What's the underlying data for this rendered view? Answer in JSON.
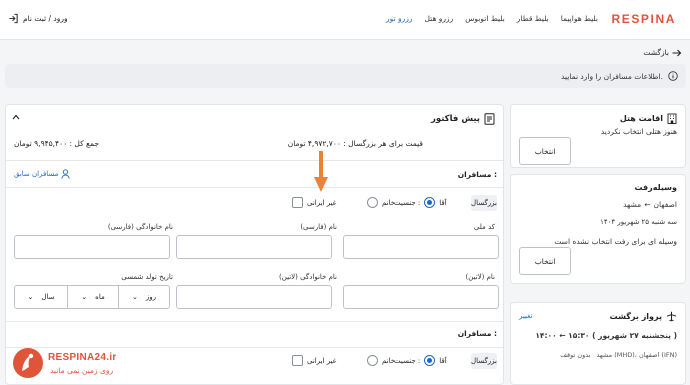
{
  "header": {
    "brand": "RESPINA",
    "nav": [
      {
        "label": "بلیط هواپیما",
        "active": false
      },
      {
        "label": "بلیط قطار",
        "active": false
      },
      {
        "label": "بلیط اتوبوس",
        "active": false
      },
      {
        "label": "رزرو هتل",
        "active": false
      },
      {
        "label": "رزرو تور",
        "active": true
      }
    ],
    "login": "ورود / ثبت نام"
  },
  "back_label": "بازگشت",
  "alert_text": "اطلاعات مسافران را وارد نمایید.",
  "invoice": {
    "title": "پیش فاکتور",
    "price_per_adult": "قیمت برای هر بزرگسال : ۴,۹۷۲,۷۰۰ تومان",
    "total": "جمع کل : ۹,۹۴۵,۴۰۰ تومان"
  },
  "passengers": {
    "title": "مسافران :",
    "prev_link": "مسافران سابق",
    "type": "بزرگسال",
    "gender_label": "جنسیت :",
    "male": "آقا",
    "female": "خانم",
    "foreign": "غیر ایرانی",
    "fields": {
      "national_code": "کد ملی",
      "name_fa": "نام (فارسی)",
      "last_name_fa": "نام خانوادگی (فارسی)",
      "name_en": "نام (لاتین)",
      "last_name_en": "نام خانوادگی (لاتین)",
      "birth_date": "تاریخ تولد شمسی"
    },
    "day": "روز",
    "month": "ماه",
    "year": "سال"
  },
  "hotel": {
    "title": "اقامت هتل",
    "text": "هنوز هتلی انتخاب نکردید",
    "button": "انتخاب"
  },
  "transport": {
    "title": "وسیله‌رفت",
    "from": "اصفهان",
    "to": "مشهد",
    "date": "سه شنبه ۲۵ شهریور ۱۴۰۴",
    "text": "وسیله ای برای رفت انتخاب نشده است",
    "button": "انتخاب"
  },
  "flight": {
    "title": "پرواز برگشت",
    "change": "تغییر",
    "times": "۱۴:۰۰ ← ۱۵:۳۰ ( پنجشنبه ۲۷ شهریور )",
    "route": "مشهد (MHD)، اصفهان (IFN)",
    "stops": "بدون توقف"
  },
  "watermark": {
    "brand": "RESPINA24.ir",
    "tagline": "روی زمین نمی مانید"
  },
  "colors": {
    "brand": "#e0543a",
    "link": "#1b67c8",
    "arrow": "#e8843a"
  }
}
